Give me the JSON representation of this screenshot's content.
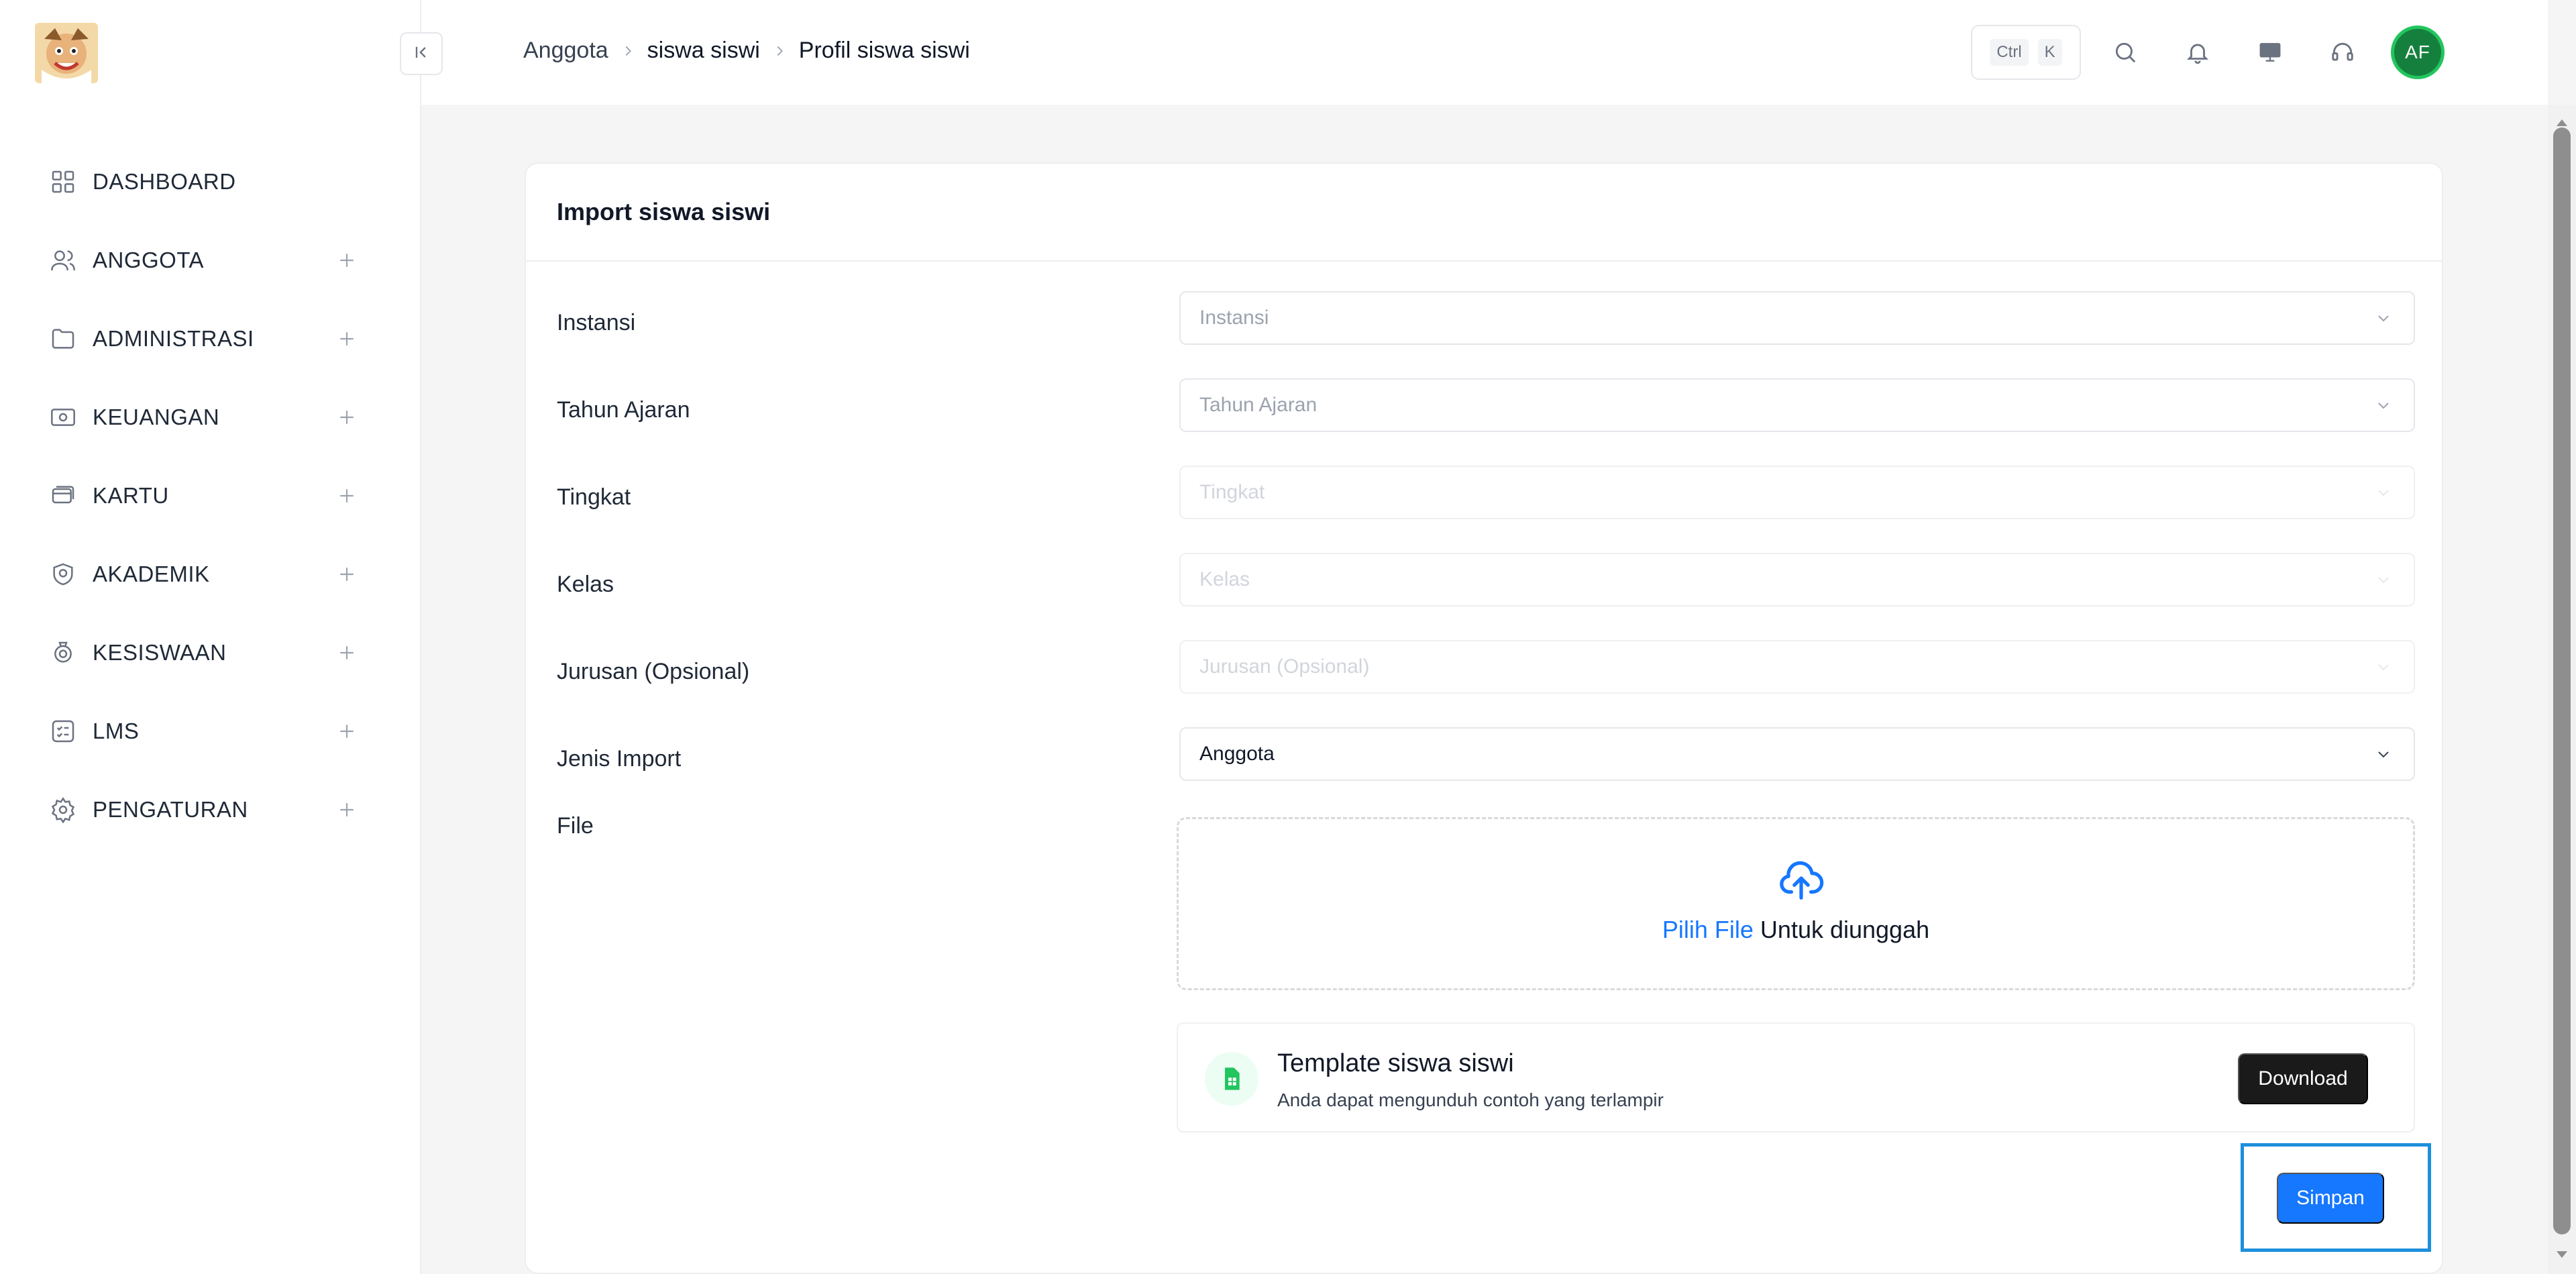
{
  "sidebar": {
    "items": [
      {
        "label": "DASHBOARD",
        "icon": "grid-icon",
        "expandable": false
      },
      {
        "label": "ANGGOTA",
        "icon": "users-icon",
        "expandable": true
      },
      {
        "label": "ADMINISTRASI",
        "icon": "folder-icon",
        "expandable": true
      },
      {
        "label": "KEUANGAN",
        "icon": "money-icon",
        "expandable": true
      },
      {
        "label": "KARTU",
        "icon": "card-icon",
        "expandable": true
      },
      {
        "label": "AKADEMIK",
        "icon": "academic-icon",
        "expandable": true
      },
      {
        "label": "KESISWAAN",
        "icon": "student-icon",
        "expandable": true
      },
      {
        "label": "LMS",
        "icon": "checklist-icon",
        "expandable": true
      },
      {
        "label": "PENGATURAN",
        "icon": "gear-icon",
        "expandable": true
      }
    ]
  },
  "header": {
    "breadcrumb": [
      "Anggota",
      "siswa siswi",
      "Profil siswa siswi"
    ],
    "shortcut": {
      "key1": "Ctrl",
      "key2": "K"
    },
    "avatar_initials": "AF"
  },
  "card": {
    "title": "Import siswa siswi",
    "fields": [
      {
        "label": "Instansi",
        "placeholder": "Instansi",
        "value": "",
        "state": "enabled"
      },
      {
        "label": "Tahun Ajaran",
        "placeholder": "Tahun Ajaran",
        "value": "",
        "state": "enabled"
      },
      {
        "label": "Tingkat",
        "placeholder": "Tingkat",
        "value": "",
        "state": "disabled"
      },
      {
        "label": "Kelas",
        "placeholder": "Kelas",
        "value": "",
        "state": "disabled"
      },
      {
        "label": "Jurusan (Opsional)",
        "placeholder": "Jurusan (Opsional)",
        "value": "",
        "state": "disabled"
      },
      {
        "label": "Jenis Import",
        "placeholder": "",
        "value": "Anggota",
        "state": "filled"
      }
    ],
    "file": {
      "label": "File",
      "upload_link": "Pilih File",
      "upload_text": " Untuk diunggah"
    },
    "template": {
      "title": "Template siswa siswi",
      "subtitle": "Anda dapat mengunduh contoh yang terlampir",
      "download_label": "Download"
    },
    "save_label": "Simpan"
  },
  "colors": {
    "primary": "#1677ff",
    "avatar": "#15803d",
    "focus": "#1c8fdc"
  }
}
